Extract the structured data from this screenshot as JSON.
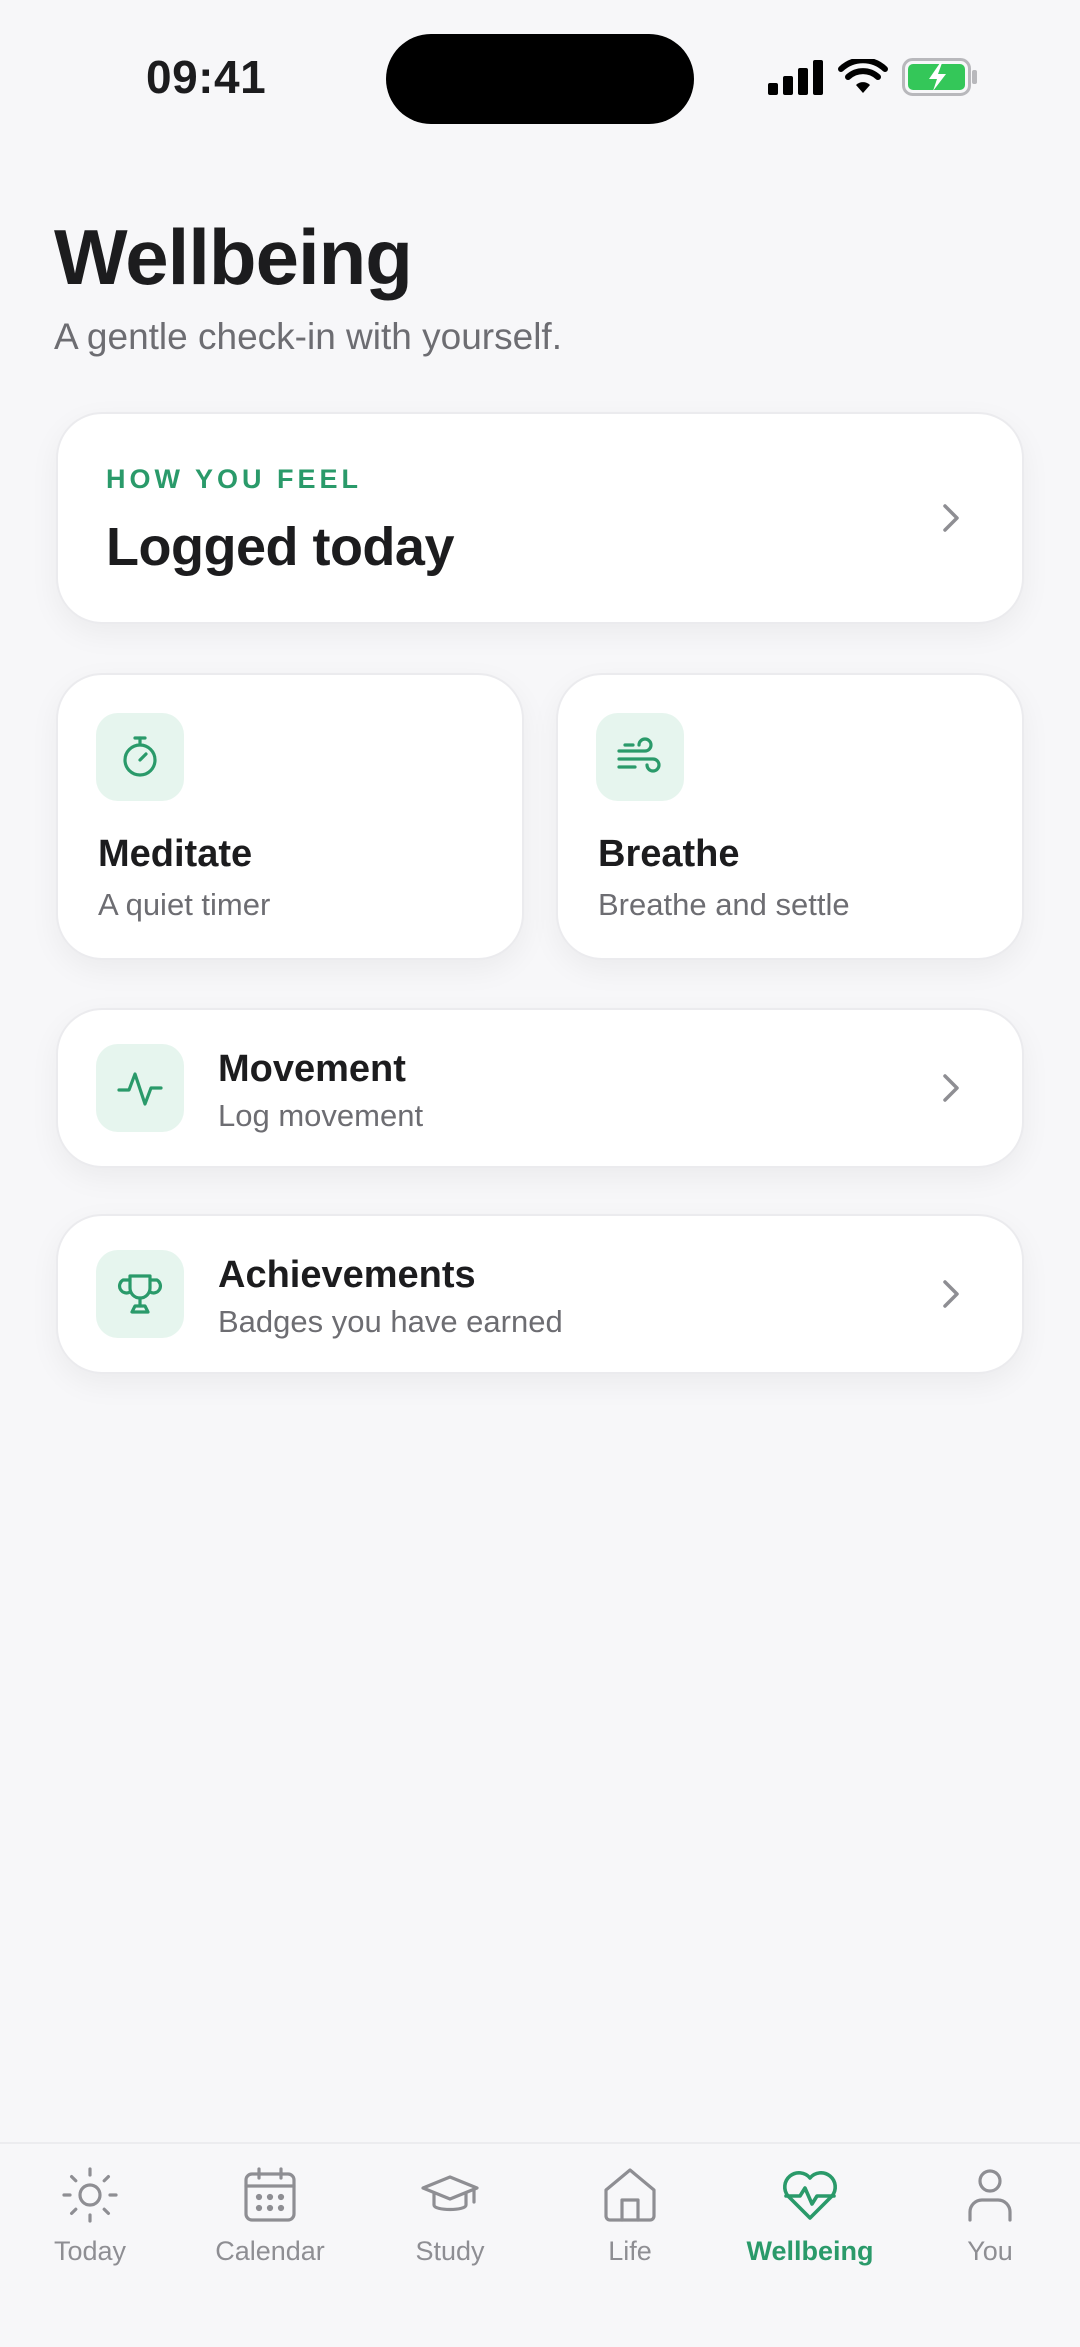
{
  "status_bar": {
    "time": "09:41"
  },
  "header": {
    "title": "Wellbeing",
    "subtitle": "A gentle check-in with yourself."
  },
  "feel_card": {
    "eyebrow": "HOW YOU FEEL",
    "value": "Logged today"
  },
  "tiles": [
    {
      "title": "Meditate",
      "subtitle": "A quiet timer",
      "icon": "timer-icon"
    },
    {
      "title": "Breathe",
      "subtitle": "Breathe and settle",
      "icon": "wind-icon"
    }
  ],
  "rows": [
    {
      "title": "Movement",
      "subtitle": "Log movement",
      "icon": "activity-icon"
    },
    {
      "title": "Achievements",
      "subtitle": "Badges you have earned",
      "icon": "trophy-icon"
    }
  ],
  "tab_bar": {
    "tabs": [
      {
        "label": "Today",
        "icon": "sun-icon"
      },
      {
        "label": "Calendar",
        "icon": "calendar-icon"
      },
      {
        "label": "Study",
        "icon": "graduation-cap-icon"
      },
      {
        "label": "Life",
        "icon": "home-icon"
      },
      {
        "label": "Wellbeing",
        "icon": "heart-pulse-icon"
      },
      {
        "label": "You",
        "icon": "user-icon"
      }
    ],
    "active": "Wellbeing"
  },
  "colors": {
    "accent": "#2a9a6a",
    "accent_bg": "#e6f5ee",
    "background": "#f7f7f9",
    "muted_text": "#6d6d72",
    "inactive_tab": "#8e8e93"
  }
}
